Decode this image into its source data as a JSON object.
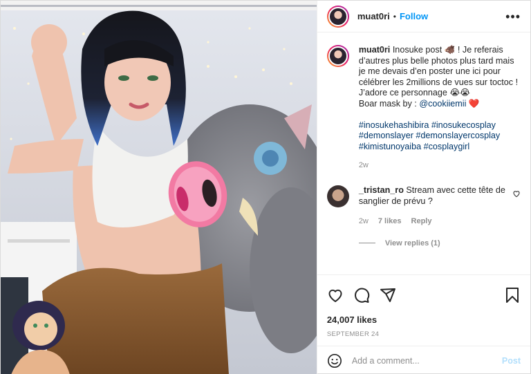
{
  "post": {
    "username": "muat0ri",
    "follow_label": "Follow",
    "separator": "•",
    "more_label": "•••"
  },
  "caption": {
    "username": "muat0ri",
    "text_line": "Inosuke post 🐗 ! Je referais d’autres plus belle photos plus tard mais je me devais d’en poster une ici pour célébrer les 2millions de vues sur toctoc ! J’adore ce personnage 😭😭",
    "credit_prefix": "Boar mask by : ",
    "credit_mention": "@cookiiemii",
    "credit_suffix": " ❤️",
    "hashtags": [
      "#inosukehashibira",
      "#inosukecosplay",
      "#demonslayer",
      "#demonslayercosplay",
      "#kimistunoyaiba",
      "#cosplaygirl"
    ],
    "age": "2w"
  },
  "comment": {
    "username": "_tristan_ro",
    "text": "Stream avec cette tête de sanglier de prévu ?",
    "age": "2w",
    "likes": "7 likes",
    "reply_label": "Reply",
    "view_replies": "View replies (1)"
  },
  "footer": {
    "likes": "24,007 likes",
    "date": "September 24",
    "add_comment_placeholder": "Add a comment...",
    "post_label": "Post"
  },
  "icons": {
    "like": "heart-icon",
    "comment": "comment-icon",
    "share": "share-icon",
    "save": "bookmark-icon",
    "emoji": "emoji-icon"
  },
  "colors": {
    "link_blue": "#0095f6",
    "hashtag_blue": "#00376b",
    "muted_gray": "#8e8e8e",
    "post_disabled": "#b2dffc"
  }
}
